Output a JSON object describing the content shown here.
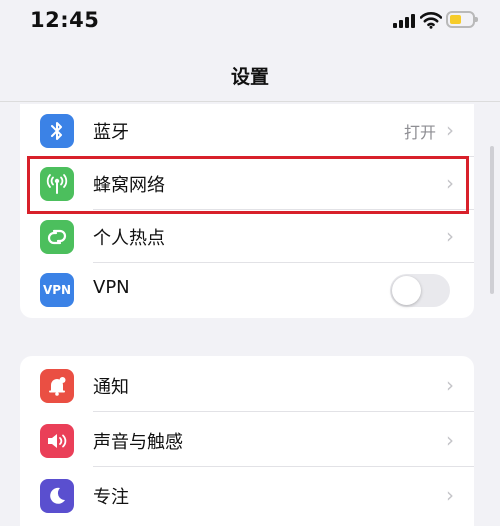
{
  "status_bar": {
    "time": "12:45"
  },
  "nav": {
    "title": "设置"
  },
  "groups": [
    {
      "rows": [
        {
          "label": "蓝牙",
          "value": "打开",
          "icon": "bluetooth-icon",
          "color": "#3b82e6"
        },
        {
          "label": "蜂窝网络",
          "icon": "antenna-icon",
          "color": "#4cbf5d"
        },
        {
          "label": "个人热点",
          "icon": "personal-hotspot-icon",
          "color": "#4cbf5d"
        },
        {
          "label": "VPN",
          "icon_text": "VPN",
          "icon": "vpn-icon",
          "color": "#3b82e6",
          "toggle_on": false
        }
      ]
    },
    {
      "rows": [
        {
          "label": "通知",
          "icon": "notification-bell-icon",
          "color": "#ea4f43"
        },
        {
          "label": "声音与触感",
          "icon": "speaker-icon",
          "color": "#ea3f58"
        },
        {
          "label": "专注",
          "icon": "moon-icon",
          "color": "#5a4fcf"
        }
      ]
    }
  ],
  "colors": {
    "highlight": "#d8202a",
    "background": "#f2f2f6"
  }
}
